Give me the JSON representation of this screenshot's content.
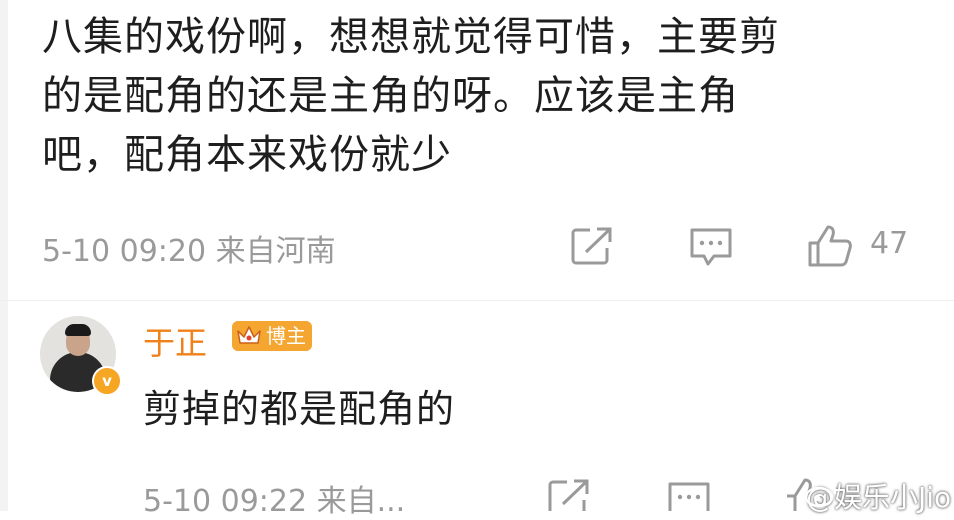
{
  "comment": {
    "line1": "八集的戏份啊，想想就觉得可惜，主要剪",
    "line2": "的是配角的还是主角的呀。应该是主角",
    "line3": "吧，配角本来戏份就少",
    "meta": "5-10 09:20  来自河南",
    "like_count": "47"
  },
  "reply": {
    "username": "于正",
    "badge": "博主",
    "text": "剪掉的都是配角的",
    "meta": "5-10 09:22  来自..."
  },
  "watermark": "@娱乐小Jio",
  "colors": {
    "username": "#f08119",
    "badge_bg": "#f4a630",
    "meta_text": "#9a9a9a"
  }
}
